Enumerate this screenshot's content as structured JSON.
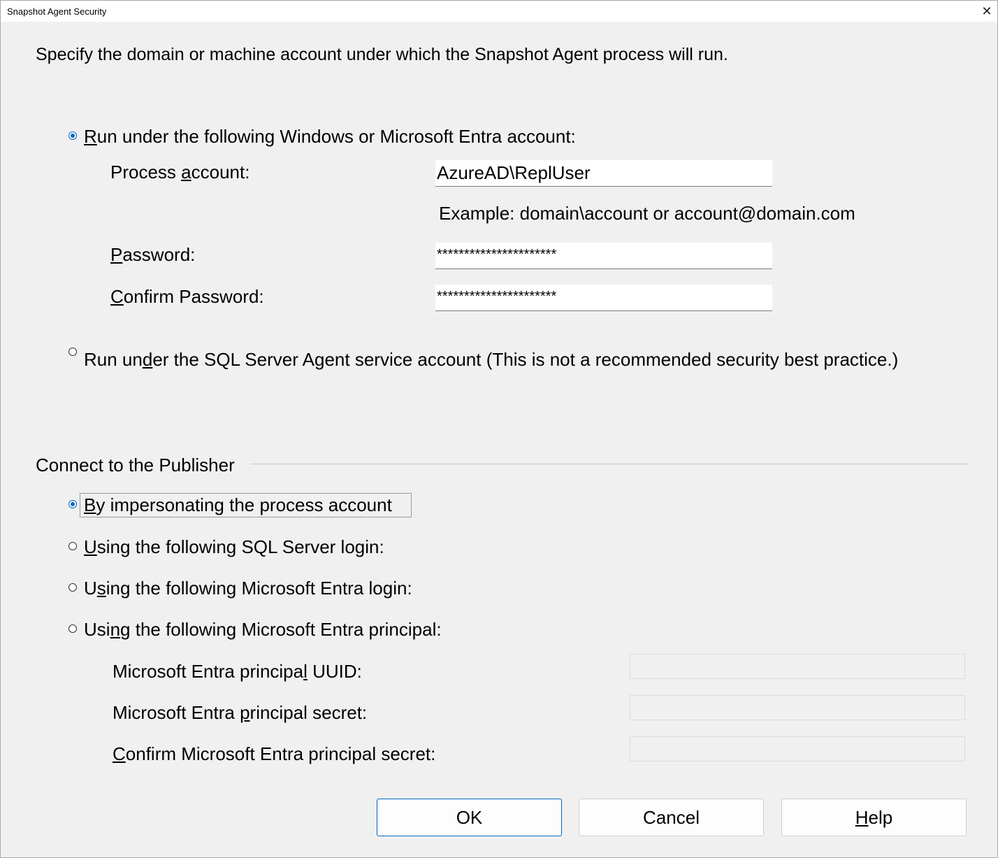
{
  "window": {
    "title": "Snapshot Agent Security"
  },
  "intro": "Specify the domain or machine account under which the Snapshot Agent process will run.",
  "run_options": {
    "windows_account": {
      "label_pre": "",
      "label_underline": "R",
      "label_post": "un under the following Windows or Microsoft Entra account:",
      "checked": true
    },
    "agent_account": {
      "label_pre": "Run un",
      "label_underline": "d",
      "label_post": "er the SQL Server Agent service account (This is not a recommended security best practice.)",
      "checked": false
    }
  },
  "process_account": {
    "label_pre": "Process ",
    "label_underline": "a",
    "label_post": "ccount:",
    "value": "AzureAD\\ReplUser",
    "example": "Example: domain\\account or account@domain.com"
  },
  "password": {
    "label_pre": "",
    "label_underline": "P",
    "label_post": "assword:",
    "value": "**********************"
  },
  "confirm_password": {
    "label_pre": "",
    "label_underline": "C",
    "label_post": "onfirm Password:",
    "value": "**********************"
  },
  "publisher": {
    "group_title": "Connect to the Publisher",
    "options": [
      {
        "label_pre": "",
        "label_underline": "B",
        "label_post": "y impersonating the process account",
        "checked": true
      },
      {
        "label_pre": "",
        "label_underline": "U",
        "label_post": "sing the following SQL Server login:",
        "checked": false
      },
      {
        "label_pre": "U",
        "label_underline": "s",
        "label_post": "ing the following Microsoft Entra login:",
        "checked": false
      },
      {
        "label_pre": "Usi",
        "label_underline": "n",
        "label_post": "g the following Microsoft Entra principal:",
        "checked": false
      }
    ],
    "principal_uuid": {
      "label_pre": "Microsoft Entra principa",
      "label_underline": "l",
      "label_post": " UUID:",
      "value": ""
    },
    "principal_secret": {
      "label_pre": "Microsoft Entra ",
      "label_underline": "p",
      "label_post": "rincipal secret:",
      "value": ""
    },
    "confirm_secret": {
      "label_pre": "",
      "label_underline": "C",
      "label_post": "onfirm Microsoft Entra principal secret:",
      "value": ""
    }
  },
  "buttons": {
    "ok": "OK",
    "cancel": "Cancel",
    "help_underline": "H",
    "help_post": "elp"
  },
  "colors": {
    "accent": "#0067c0",
    "background": "#f0f0f0"
  }
}
